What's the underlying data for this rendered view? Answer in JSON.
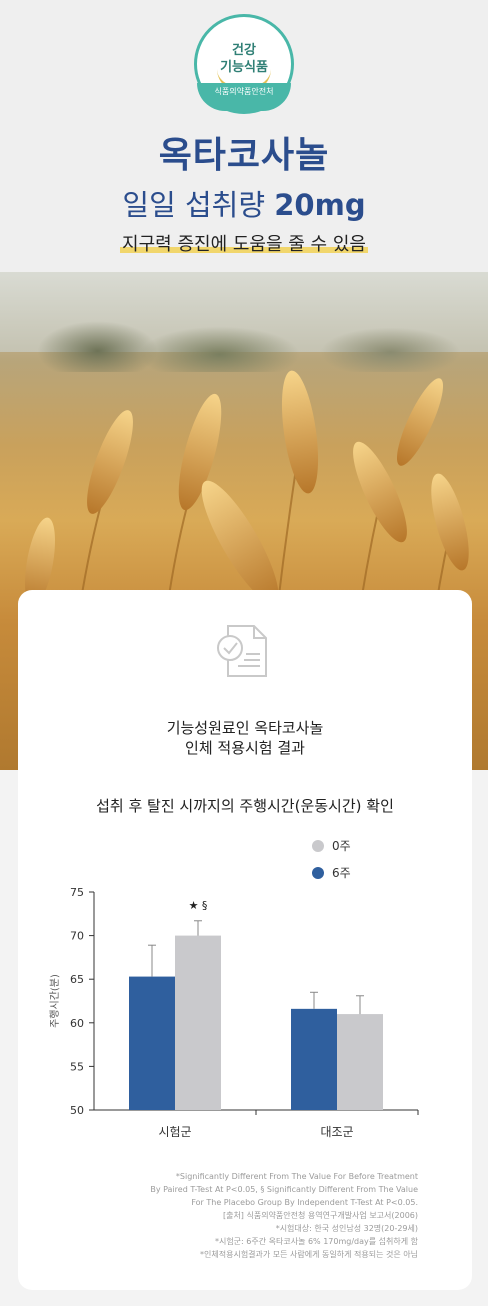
{
  "badge": {
    "line1": "건강",
    "line2": "기능식품",
    "agency": "식품의약품안전처"
  },
  "header": {
    "title": "옥타코사놀",
    "dose_label": "일일 섭취량",
    "dose_value": "20mg",
    "claim": "지구력 증진에 도움을 줄 수 있음"
  },
  "card": {
    "icon": "document-check-icon",
    "heading_line1": "기능성원료인 옥타코사놀",
    "heading_line2": "인체 적용시험 결과",
    "chart_heading": "섭취 후 탈진 시까지의 주행시간(운동시간) 확인"
  },
  "colors": {
    "navy": "#2b4d8d",
    "series_6w": "#2f5f9e",
    "series_0w": "#c9c9cc",
    "badge": "#49b7a8",
    "highlight": "#f1d66c"
  },
  "chart_data": {
    "type": "bar",
    "categories": [
      "시험군",
      "대조군"
    ],
    "series": [
      {
        "name": "6주",
        "values": [
          65.3,
          61.6
        ],
        "errors": [
          3.6,
          1.9
        ],
        "color": "#2f5f9e"
      },
      {
        "name": "0주",
        "values": [
          70.0,
          61.0
        ],
        "errors": [
          1.7,
          2.1
        ],
        "color": "#c9c9cc"
      }
    ],
    "bar_order": [
      "6주",
      "0주"
    ],
    "legend": [
      {
        "label": "0주",
        "color": "#c9c9cc"
      },
      {
        "label": "6주",
        "color": "#2f5f9e"
      }
    ],
    "legend_position": "top-right",
    "ylabel": "주행시간(분)",
    "ylim": [
      50,
      75
    ],
    "yticks": [
      50,
      55,
      60,
      65,
      70,
      75
    ],
    "annotation": "★ §",
    "grid": false
  },
  "footnotes": [
    "*Significantly Different From The Value For Before Treatment",
    "By Paired T-Test At P<0.05, § Significantly Different From The Value",
    "For The Placebo Group By Independent T-Test At P<0.05.",
    "[출처] 식품의약품안전청 용역연구개발사업 보고서(2006)",
    "*시험대상: 한국 성인남성 32명(20-29세)",
    "*시험군: 6주간 옥타코사놀 6% 170mg/day를 섭취하게 함",
    "*인체적용시험결과가 모든 사람에게 동일하게 적용되는 것은 아님"
  ]
}
